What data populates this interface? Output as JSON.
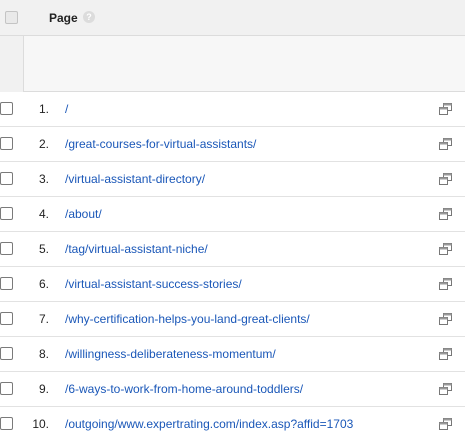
{
  "header": {
    "column_label": "Page",
    "help_glyph": "?"
  },
  "rows": [
    {
      "num": "1.",
      "path": "/"
    },
    {
      "num": "2.",
      "path": "/great-courses-for-virtual-assistants/"
    },
    {
      "num": "3.",
      "path": "/virtual-assistant-directory/"
    },
    {
      "num": "4.",
      "path": "/about/"
    },
    {
      "num": "5.",
      "path": "/tag/virtual-assistant-niche/"
    },
    {
      "num": "6.",
      "path": "/virtual-assistant-success-stories/"
    },
    {
      "num": "7.",
      "path": "/why-certification-helps-you-land-great-clients/"
    },
    {
      "num": "8.",
      "path": "/willingness-deliberateness-momentum/"
    },
    {
      "num": "9.",
      "path": "/6-ways-to-work-from-home-around-toddlers/"
    },
    {
      "num": "10.",
      "path": "/outgoing/www.expertrating.com/index.asp?affid=1703"
    }
  ],
  "colors": {
    "link": "#1a57b8",
    "header_bg": "#f1f1f1"
  },
  "icons": {
    "row_action": "open-in-new-window-icon",
    "header_help": "help-icon"
  }
}
